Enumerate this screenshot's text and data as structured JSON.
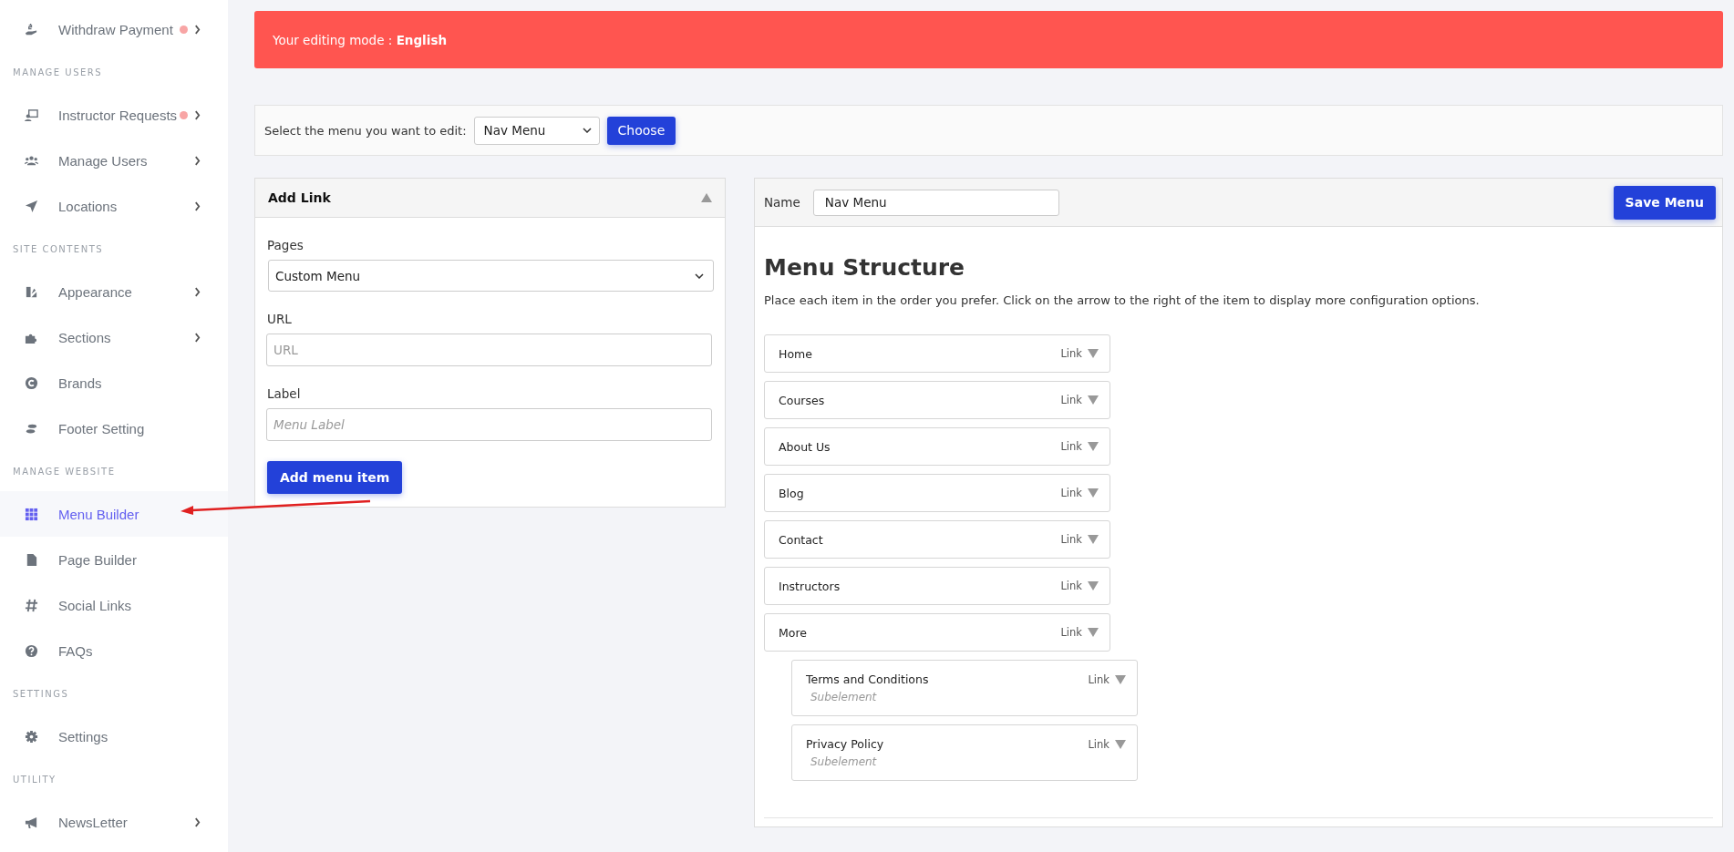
{
  "sidebar": {
    "items": [
      {
        "kind": "item",
        "label": "Withdraw Payment",
        "notification": true,
        "expandable": true,
        "selected": false
      },
      {
        "kind": "heading",
        "label": "MANAGE USERS"
      },
      {
        "kind": "item",
        "label": "Instructor Requests",
        "notification": true,
        "expandable": true,
        "selected": false
      },
      {
        "kind": "item",
        "label": "Manage Users",
        "notification": false,
        "expandable": true,
        "selected": false
      },
      {
        "kind": "item",
        "label": "Locations",
        "notification": false,
        "expandable": true,
        "selected": false
      },
      {
        "kind": "heading",
        "label": "SITE CONTENTS"
      },
      {
        "kind": "item",
        "label": "Appearance",
        "notification": false,
        "expandable": true,
        "selected": false
      },
      {
        "kind": "item",
        "label": "Sections",
        "notification": false,
        "expandable": true,
        "selected": false
      },
      {
        "kind": "item",
        "label": "Brands",
        "notification": false,
        "expandable": false,
        "selected": false
      },
      {
        "kind": "item",
        "label": "Footer Setting",
        "notification": false,
        "expandable": false,
        "selected": false
      },
      {
        "kind": "heading",
        "label": "MANAGE WEBSITE"
      },
      {
        "kind": "item",
        "label": "Menu Builder",
        "notification": false,
        "expandable": false,
        "selected": true
      },
      {
        "kind": "item",
        "label": "Page Builder",
        "notification": false,
        "expandable": false,
        "selected": false
      },
      {
        "kind": "item",
        "label": "Social Links",
        "notification": false,
        "expandable": false,
        "selected": false
      },
      {
        "kind": "item",
        "label": "FAQs",
        "notification": false,
        "expandable": false,
        "selected": false
      },
      {
        "kind": "heading",
        "label": "SETTINGS"
      },
      {
        "kind": "item",
        "label": "Settings",
        "notification": false,
        "expandable": false,
        "selected": false
      },
      {
        "kind": "heading",
        "label": "UTILITY"
      },
      {
        "kind": "item",
        "label": "NewsLetter",
        "notification": false,
        "expandable": true,
        "selected": false
      }
    ]
  },
  "banner": {
    "text": "Your editing mode : **English**"
  },
  "menu_select": {
    "label": "Select the menu you want to edit:",
    "value": "Nav Menu",
    "button": "Choose"
  },
  "add_link": {
    "title": "Add Link",
    "pages_label": "Pages",
    "pages_value": "Custom Menu",
    "url_label": "URL",
    "url_placeholder": "URL",
    "label_label": "Label",
    "label_placeholder": "Menu Label",
    "button": "Add menu item"
  },
  "menu_editor": {
    "name_label": "Name",
    "name_value": "Nav Menu",
    "save_button": "Save Menu",
    "heading": "Menu Structure",
    "description": "Place each item in the order you prefer. Click on the arrow to the right of the item to display more configuration options.",
    "items": [
      {
        "label": "Home",
        "type": "Link"
      },
      {
        "label": "Courses",
        "type": "Link"
      },
      {
        "label": "About Us",
        "type": "Link"
      },
      {
        "label": "Blog",
        "type": "Link"
      },
      {
        "label": "Contact",
        "type": "Link"
      },
      {
        "label": "Instructors",
        "type": "Link"
      },
      {
        "label": "More",
        "type": "Link",
        "children": [
          {
            "label": "Terms and Conditions",
            "type": "Link",
            "note": "Subelement"
          },
          {
            "label": "Privacy Policy",
            "type": "Link",
            "note": "Subelement"
          }
        ]
      }
    ]
  }
}
